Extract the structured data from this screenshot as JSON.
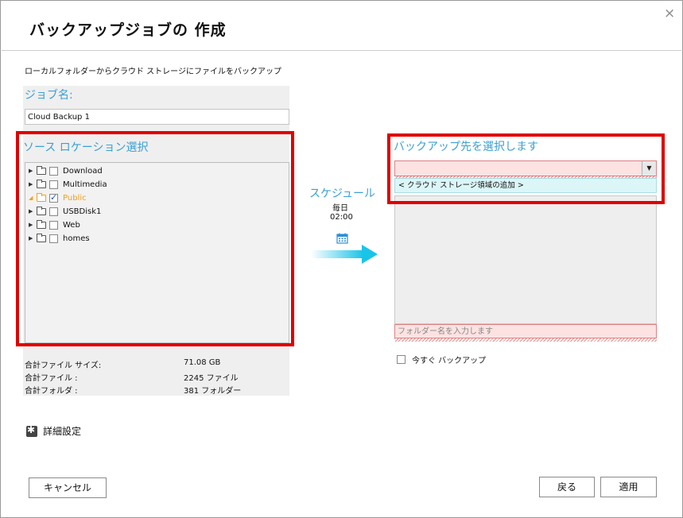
{
  "dialog": {
    "title": "バックアップジョブの 作成",
    "close_glyph": "×",
    "subtitle": "ローカルフォルダーからクラウド ストレージにファイルをバックアップ"
  },
  "job": {
    "label": "ジョブ名:",
    "value": "Cloud Backup 1"
  },
  "source": {
    "label": "ソース ロケーション選択",
    "tree": [
      {
        "label": "Download",
        "checked": false,
        "expanded": false,
        "selected": false
      },
      {
        "label": "Multimedia",
        "checked": false,
        "expanded": false,
        "selected": false
      },
      {
        "label": "Public",
        "checked": true,
        "expanded": true,
        "selected": true
      },
      {
        "label": "USBDisk1",
        "checked": false,
        "expanded": false,
        "selected": false
      },
      {
        "label": "Web",
        "checked": false,
        "expanded": false,
        "selected": false
      },
      {
        "label": "homes",
        "checked": false,
        "expanded": false,
        "selected": false
      }
    ]
  },
  "stats": [
    {
      "name": "合計ファイル サイズ:",
      "value": "71.08 GB"
    },
    {
      "name": "合計ファイル :",
      "value": "2245 ファイル"
    },
    {
      "name": "合計フォルダ :",
      "value": "381 フォルダー"
    }
  ],
  "schedule": {
    "label": "スケジュール",
    "frequency": "毎日",
    "time": "02:00"
  },
  "destination": {
    "label": "バックアップ先を選択します",
    "selected_value": "",
    "option": "< クラウド ストレージ領域の追加 >",
    "folder_placeholder": "フォルダー名を入力します"
  },
  "backup_now": {
    "label": "今すぐ バックアップ",
    "checked": false
  },
  "advanced": {
    "label": "詳細設定"
  },
  "buttons": {
    "cancel": "キャンセル",
    "back": "戻る",
    "apply": "適用"
  },
  "colors": {
    "accent": "#3aa0d4",
    "highlight": "#e00000",
    "selected_folder": "#f0a020",
    "arrow": "#19c4e8"
  },
  "icons": {
    "schedule": "calendar-icon",
    "advanced": "gear-icon"
  }
}
